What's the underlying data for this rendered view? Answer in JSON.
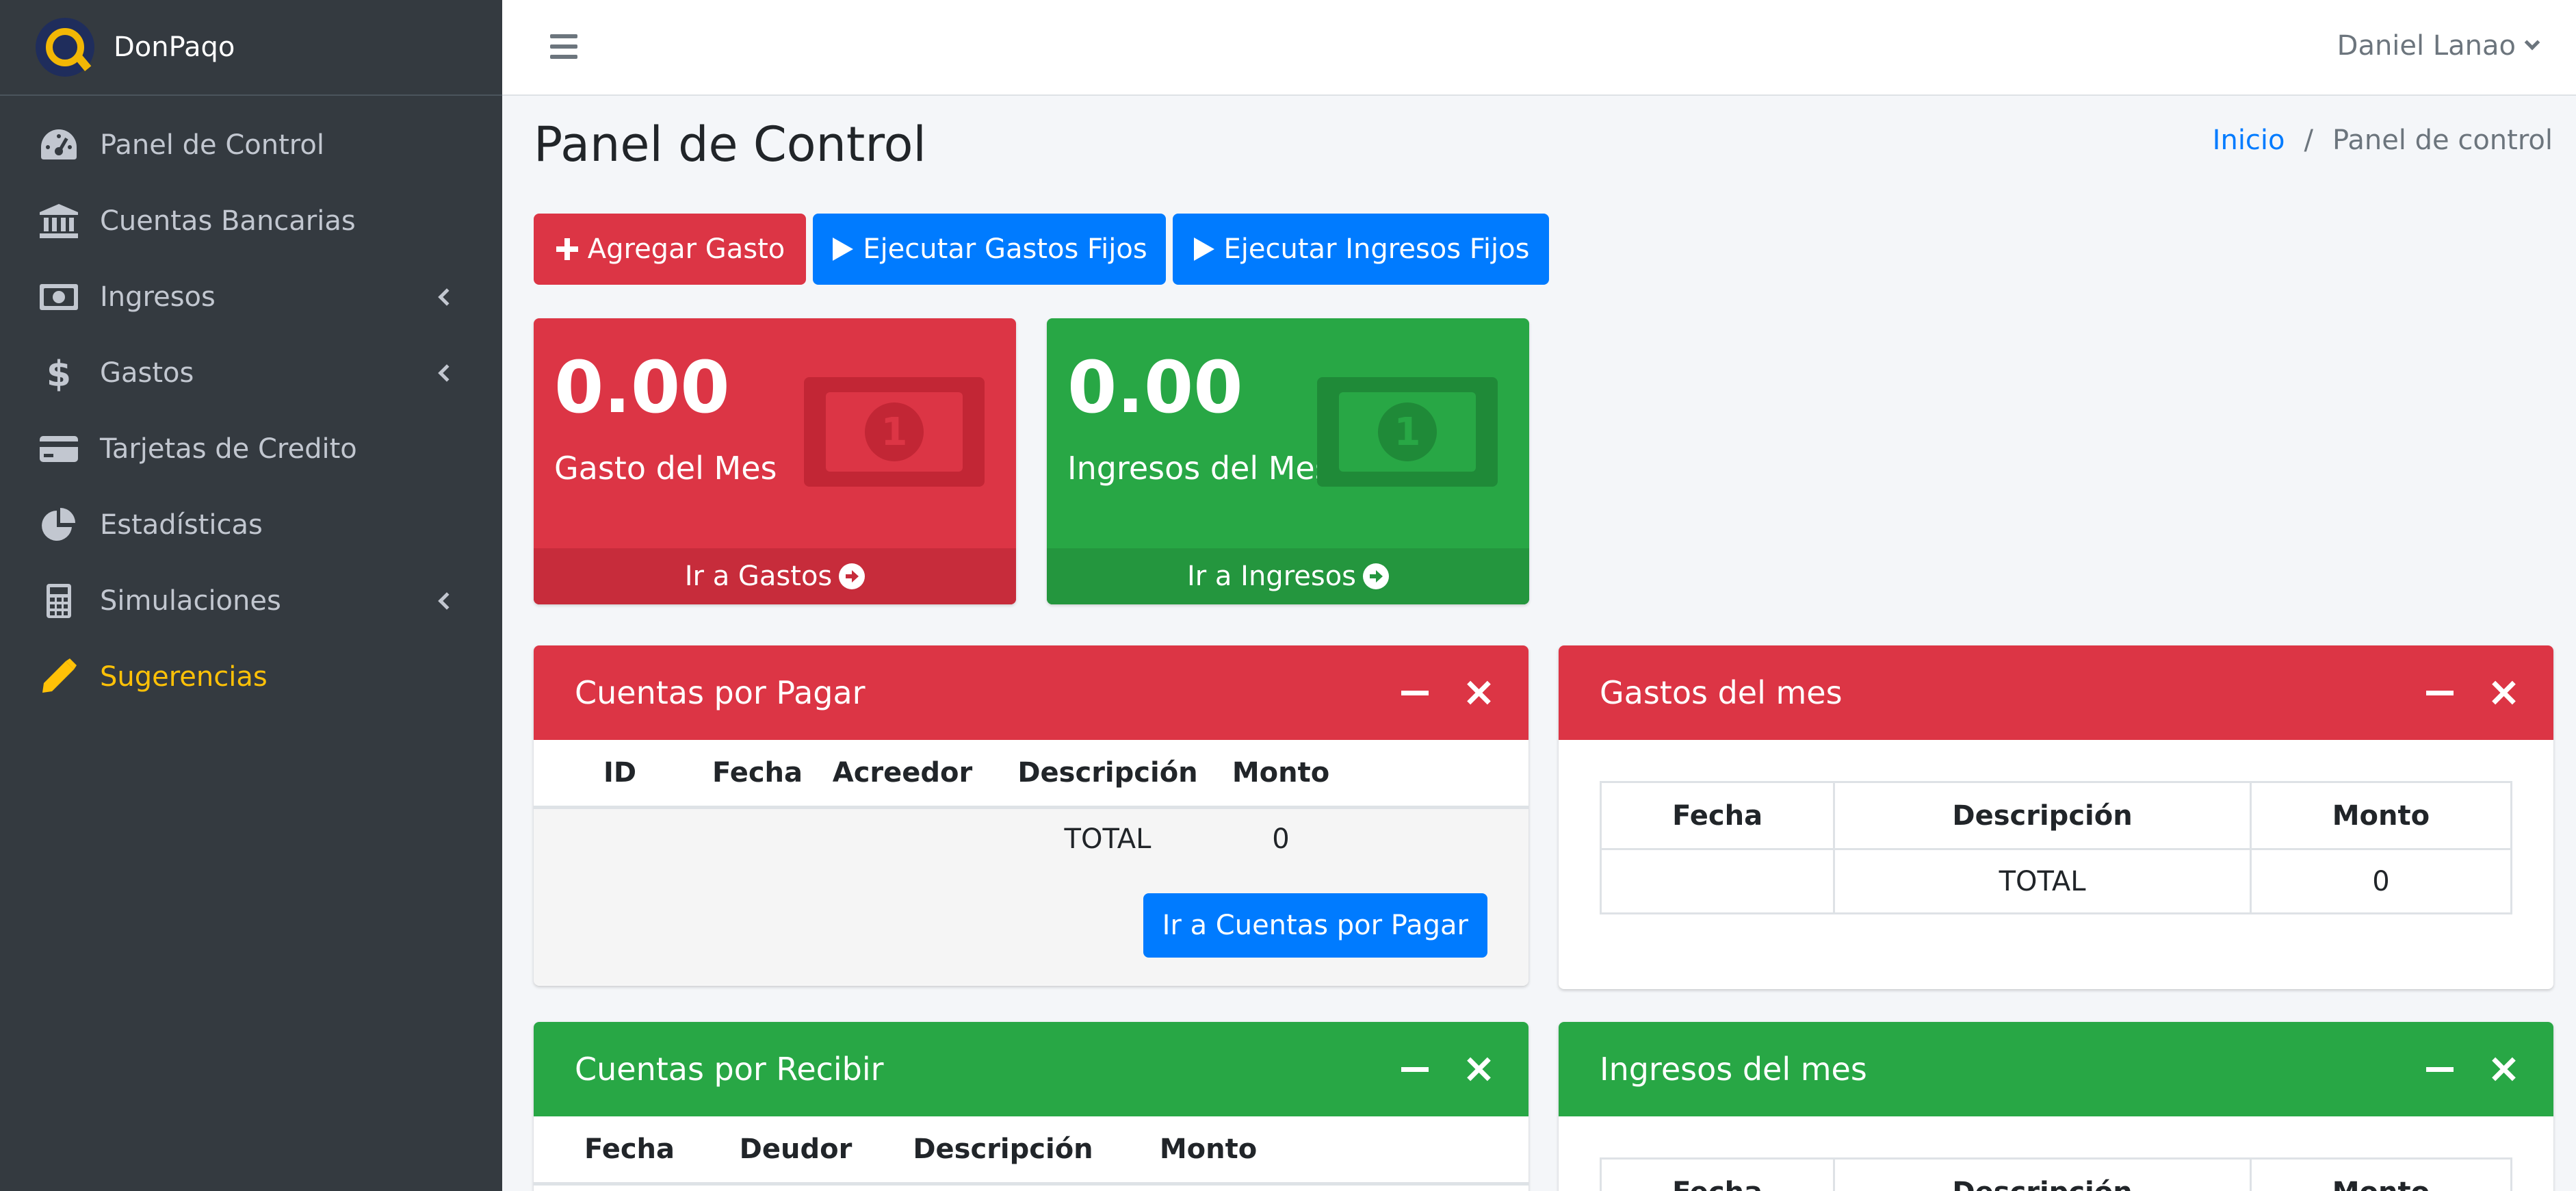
{
  "brand": {
    "name": "DonPaqo"
  },
  "sidebar": {
    "items": [
      {
        "label": "Panel de Control",
        "icon": "tachometer-icon"
      },
      {
        "label": "Cuentas Bancarias",
        "icon": "bank-icon"
      },
      {
        "label": "Ingresos",
        "icon": "money-bill-icon",
        "has_submenu": true
      },
      {
        "label": "Gastos",
        "icon": "dollar-sign-icon",
        "has_submenu": true
      },
      {
        "label": "Tarjetas de Credito",
        "icon": "credit-card-icon"
      },
      {
        "label": "Estadísticas",
        "icon": "pie-chart-icon"
      },
      {
        "label": "Simulaciones",
        "icon": "calculator-icon",
        "has_submenu": true
      },
      {
        "label": "Sugerencias",
        "icon": "pencil-icon",
        "highlight_color": "#ffc107"
      }
    ]
  },
  "header": {
    "user_name": "Daniel Lanao"
  },
  "content": {
    "title": "Panel de Control",
    "breadcrumb": {
      "home": "Inicio",
      "separator": "/",
      "current": "Panel de control"
    }
  },
  "actions": {
    "add_expense": "Agregar Gasto",
    "run_fixed_expenses": "Ejecutar Gastos Fijos",
    "run_fixed_income": "Ejecutar Ingresos Fijos"
  },
  "boxes": {
    "expense": {
      "value": "0.00",
      "label": "Gasto del Mes",
      "link": "Ir a Gastos",
      "coin": "1"
    },
    "income": {
      "value": "0.00",
      "label": "Ingresos del Mes",
      "link": "Ir a Ingresos",
      "coin": "1"
    }
  },
  "cards": {
    "payable": {
      "title": "Cuentas por Pagar",
      "columns": [
        "ID",
        "Fecha",
        "Acreedor",
        "Descripción",
        "Monto"
      ],
      "total_label": "TOTAL",
      "total_value": "0",
      "button": "Ir a Cuentas por Pagar"
    },
    "month_expenses": {
      "title": "Gastos del mes",
      "columns": [
        "Fecha",
        "Descripción",
        "Monto"
      ],
      "total_label": "TOTAL",
      "total_value": "0"
    },
    "receivable": {
      "title": "Cuentas por Recibir",
      "columns": [
        "Fecha",
        "Deudor",
        "Descripción",
        "Monto"
      ]
    },
    "month_income": {
      "title": "Ingresos del mes",
      "columns": [
        "Fecha",
        "Descripción",
        "Monto"
      ]
    }
  },
  "colors": {
    "danger": "#dc3545",
    "success": "#28a745",
    "primary": "#007bff",
    "sidebar_bg": "#343a40",
    "warning": "#ffc107"
  }
}
